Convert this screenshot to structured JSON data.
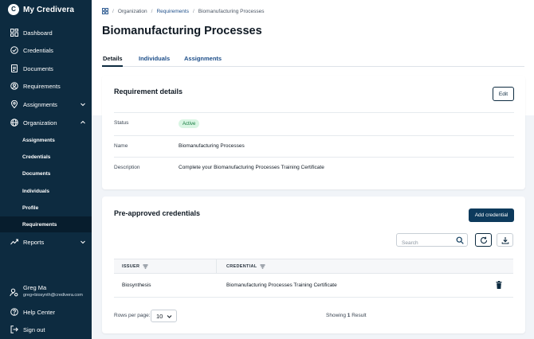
{
  "app": {
    "name": "My Credivera"
  },
  "sidebar": {
    "items": [
      {
        "label": "Dashboard"
      },
      {
        "label": "Credentials"
      },
      {
        "label": "Documents"
      },
      {
        "label": "Requirements"
      },
      {
        "label": "Assignments"
      },
      {
        "label": "Organization"
      },
      {
        "label": "Reports"
      }
    ],
    "org_sub_items": [
      {
        "label": "Assignments"
      },
      {
        "label": "Credentials"
      },
      {
        "label": "Documents"
      },
      {
        "label": "Individuals"
      },
      {
        "label": "Profile"
      },
      {
        "label": "Requirements"
      }
    ],
    "user": {
      "name": "Greg Ma",
      "email": "greg+biosynth@credivera.com"
    },
    "help_label": "Help Center",
    "signout_label": "Sign out"
  },
  "breadcrumb": {
    "org": "Organization",
    "requirements": "Requirements",
    "current": "Biomanufacturing Processes"
  },
  "page": {
    "title": "Biomanufacturing Processes"
  },
  "tabs": [
    {
      "label": "Details"
    },
    {
      "label": "Individuals"
    },
    {
      "label": "Assignments"
    }
  ],
  "requirement_details": {
    "title": "Requirement details",
    "edit_label": "Edit",
    "status_label": "Status",
    "status_value": "Active",
    "name_label": "Name",
    "name_value": "Biomanufacturing Processes",
    "description_label": "Description",
    "description_value": "Complete your Biomanufacturing Processes Training Certificate"
  },
  "preapproved": {
    "title": "Pre-approved credentials",
    "add_label": "Add credential",
    "search_placeholder": "Search",
    "columns": {
      "issuer": "ISSUER",
      "credential": "CREDENTIAL"
    },
    "rows": [
      {
        "issuer": "Biosynthesis",
        "credential": "Biomanufacturing Processes Training Certificate"
      }
    ],
    "rows_per_page_label": "Rows per page:",
    "rows_per_page_value": "10",
    "showing_prefix": "Showing",
    "showing_count": "1",
    "showing_suffix": "Result"
  },
  "colors": {
    "sidebar": "#0d2b40",
    "primary": "#0d3a5c",
    "link": "#1d4e89",
    "active_badge_bg": "#d9f5e3",
    "active_badge_text": "#157a3f"
  }
}
